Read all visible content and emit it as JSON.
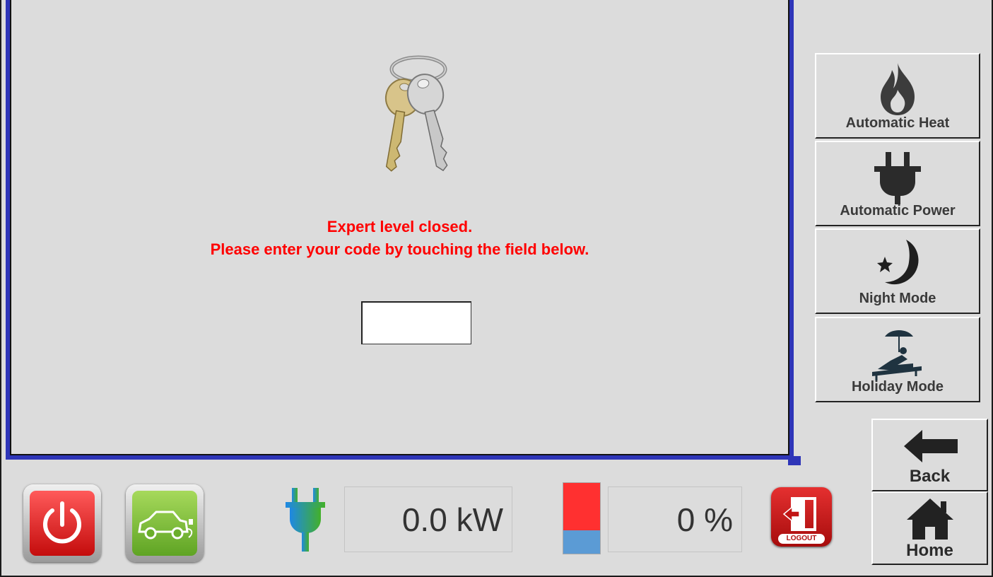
{
  "message": {
    "line1": "Expert level closed.",
    "line2": "Please enter your code by touching the field below."
  },
  "code_field": {
    "value": ""
  },
  "sidebar": {
    "items": [
      {
        "label": "Automatic Heat",
        "icon": "flame-icon"
      },
      {
        "label": "Automatic Power",
        "icon": "plug-icon"
      },
      {
        "label": "Night Mode",
        "icon": "moon-star-icon"
      },
      {
        "label": "Holiday Mode",
        "icon": "sunbed-umbrella-icon"
      }
    ]
  },
  "nav": {
    "back_label": "Back",
    "home_label": "Home"
  },
  "footer": {
    "power_reading": "0.0 kW",
    "level_reading": "0 %",
    "level_fraction": 0.33,
    "logout_label": "LOGOUT"
  },
  "colors": {
    "panel_border": "#2e35b8",
    "alert_text": "#ff0000",
    "power_button": "#e21a1a",
    "ev_button": "#7cc234"
  }
}
